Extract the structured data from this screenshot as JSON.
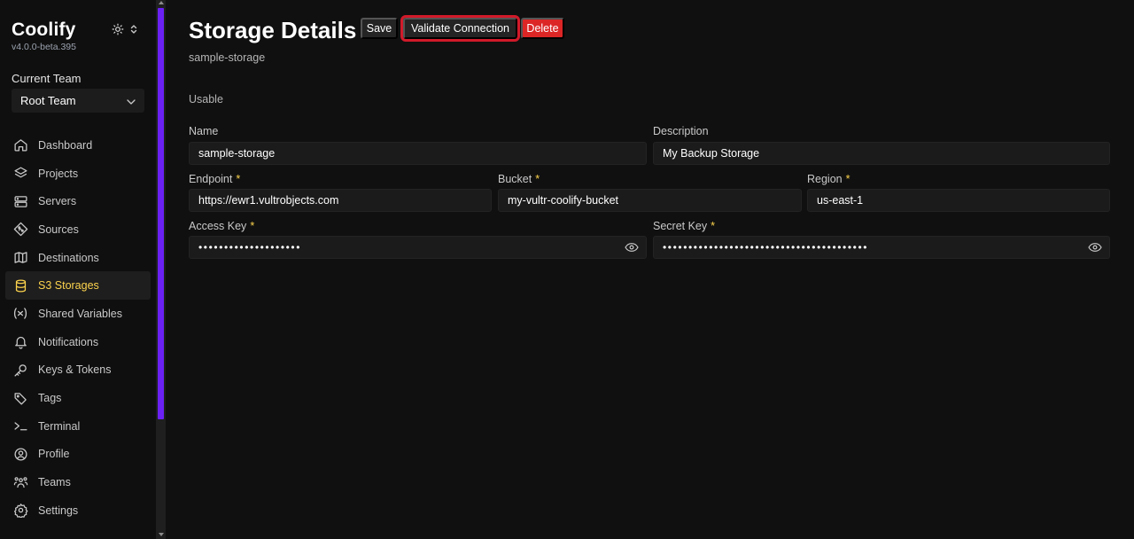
{
  "app": {
    "name": "Coolify",
    "version": "v4.0.0-beta.395"
  },
  "team": {
    "label": "Current Team",
    "selected": "Root Team"
  },
  "nav": [
    {
      "label": "Dashboard",
      "icon": "home-icon",
      "active": false
    },
    {
      "label": "Projects",
      "icon": "layers-icon",
      "active": false
    },
    {
      "label": "Servers",
      "icon": "server-icon",
      "active": false
    },
    {
      "label": "Sources",
      "icon": "git-icon",
      "active": false
    },
    {
      "label": "Destinations",
      "icon": "map-icon",
      "active": false
    },
    {
      "label": "S3 Storages",
      "icon": "database-icon",
      "active": true
    },
    {
      "label": "Shared Variables",
      "icon": "variable-icon",
      "active": false
    },
    {
      "label": "Notifications",
      "icon": "bell-icon",
      "active": false
    },
    {
      "label": "Keys & Tokens",
      "icon": "key-icon",
      "active": false
    },
    {
      "label": "Tags",
      "icon": "tags-icon",
      "active": false
    },
    {
      "label": "Terminal",
      "icon": "terminal-icon",
      "active": false
    },
    {
      "label": "Profile",
      "icon": "user-circle-icon",
      "active": false
    },
    {
      "label": "Teams",
      "icon": "users-icon",
      "active": false
    },
    {
      "label": "Settings",
      "icon": "gear-icon",
      "active": false
    }
  ],
  "page": {
    "title": "Storage Details",
    "subtitle": "sample-storage",
    "status": "Usable"
  },
  "toolbar": {
    "save_label": "Save",
    "validate_label": "Validate Connection",
    "delete_label": "Delete"
  },
  "form": {
    "name": {
      "label": "Name",
      "value": "sample-storage"
    },
    "description": {
      "label": "Description",
      "value": "My Backup Storage"
    },
    "endpoint": {
      "label": "Endpoint",
      "value": "https://ewr1.vultrobjects.com"
    },
    "bucket": {
      "label": "Bucket",
      "value": "my-vultr-coolify-bucket"
    },
    "region": {
      "label": "Region",
      "value": "us-east-1"
    },
    "access_key": {
      "label": "Access Key",
      "value": "••••••••••••••••••••"
    },
    "secret_key": {
      "label": "Secret Key",
      "value": "••••••••••••••••••••••••••••••••••••••••"
    },
    "required_mark": "*"
  },
  "colors": {
    "accent": "#fcd34d",
    "scroll_thumb": "#6b21f4",
    "danger": "#dc2626",
    "highlight_outline": "#d11a2a"
  }
}
